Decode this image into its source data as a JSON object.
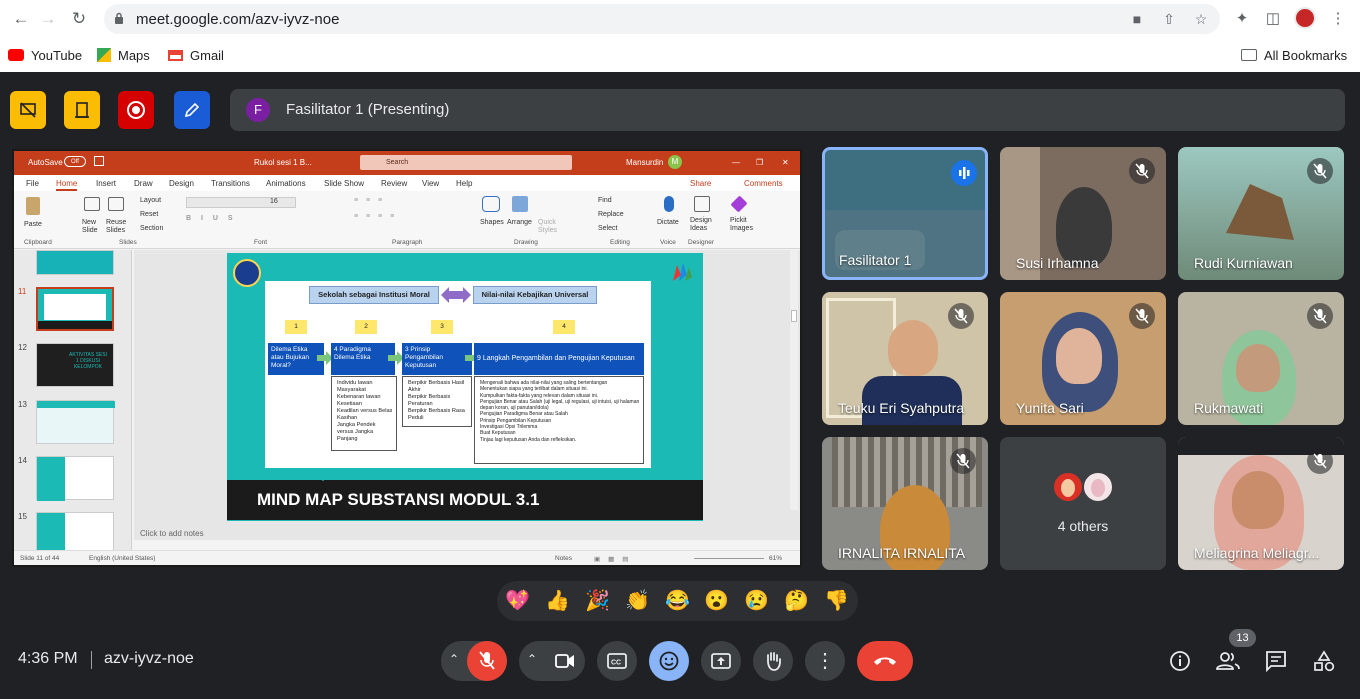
{
  "browser": {
    "url": "meet.google.com/azv-iyvz-noe",
    "bookmarks": [
      "YouTube",
      "Maps",
      "Gmail"
    ],
    "all_bookmarks": "All Bookmarks"
  },
  "meet": {
    "presenter_initial": "F",
    "presenting_label": "Fasilitator 1 (Presenting)",
    "time": "4:36 PM",
    "meeting_code": "azv-iyvz-noe",
    "participant_count": "13",
    "others_label": "4 others"
  },
  "participants": [
    {
      "name": "Fasilitator 1",
      "speaking": true
    },
    {
      "name": "Susi Irhamna",
      "muted": true
    },
    {
      "name": "Rudi Kurniawan",
      "muted": true
    },
    {
      "name": "Teuku Eri Syahputra",
      "muted": true
    },
    {
      "name": "Yunita Sari",
      "muted": true
    },
    {
      "name": "Rukmawati",
      "muted": true
    },
    {
      "name": "IRNALITA IRNALITA",
      "muted": true
    },
    {
      "name": "Meliagrina Meliagr...",
      "muted": true
    }
  ],
  "reactions": [
    "💖",
    "👍",
    "🎉",
    "👏",
    "😂",
    "😮",
    "😢",
    "🤔",
    "👎"
  ],
  "ppt": {
    "autosave": "AutoSave",
    "autosave_state": "Off",
    "file_name": "Rukol sesi 1 B...",
    "search": "Search",
    "user": "Mansurdin",
    "user_initial": "M",
    "menu": [
      "File",
      "Home",
      "Insert",
      "Draw",
      "Design",
      "Transitions",
      "Animations",
      "Slide Show",
      "Review",
      "View",
      "Help"
    ],
    "share": "Share",
    "comments": "Comments",
    "ribbon": {
      "paste": "Paste",
      "clipboard": "Clipboard",
      "new_slide": "New Slide",
      "reuse_slides": "Reuse Slides",
      "layout": "Layout",
      "reset": "Reset",
      "section": "Section",
      "slides": "Slides",
      "font_size": "16",
      "font": "Font",
      "paragraph": "Paragraph",
      "shapes": "Shapes",
      "arrange": "Arrange",
      "quick_styles": "Quick Styles",
      "drawing": "Drawing",
      "find": "Find",
      "replace": "Replace",
      "select": "Select",
      "editing": "Editing",
      "dictate": "Dictate",
      "voice": "Voice",
      "design_ideas": "Design Ideas",
      "designer": "Designer",
      "pickit": "Pickit Images"
    },
    "thumb_numbers": [
      "11",
      "12",
      "13",
      "14",
      "15"
    ],
    "thumb12_text": "AKTIVITAS SESI 1 DISKUSI KELOMPOK",
    "notes_placeholder": "Click to add notes",
    "status": {
      "slide": "Slide 11 of 44",
      "language": "English (United States)",
      "notes": "Notes",
      "zoom": "61%"
    },
    "slide": {
      "header_left": "Sekolah sebagai Institusi Moral",
      "header_right": "Nilai-nilai Kebajikan Universal",
      "numbers": [
        "1",
        "2",
        "3",
        "4"
      ],
      "col1_head": "Dilema Etika atau Bujukan Moral?",
      "col2_head": "4 Paradigma Dilema Etika",
      "col3_head": "3 Prinsip Pengambilan Keputusan",
      "col4_head": "9 Langkah Pengambilan dan Pengujian Keputusan",
      "col2_items": [
        "Individu lawan Masyarakat",
        "Kebenaran lawan Kesetiaan",
        "Keadilan versus Belas Kasihan",
        "Jangka Pendek versus Jangka Panjang"
      ],
      "col3_items": [
        "Berpikir Berbasis Hasil Akhir",
        "Berpikir Berbasis Peraturan",
        "Berpikir Berbasis Rasa Peduli"
      ],
      "col4_items": [
        "Mengenali bahwa ada nilai-nilai yang saling bertentangan",
        "Menentukan siapa yang terlibat dalam situasi ini.",
        "Kumpulkan fakta-fakta yang relevan dalam situasi ini.",
        "Pengujian Benar atau Salah (uji legal, uji regulasi, uji intuisi, uji halaman depan koran, uji panutan/idola)",
        "Pengujian Paradigma Benar atau Salah",
        "Prinsip Pengambilan Keputusan",
        "Investigasi Opsi Trilemma",
        "Buat Keputusan",
        "Tinjau lagi keputusan Anda dan refleksikan."
      ],
      "title": "MIND MAP SUBSTANSI MODUL 3.1"
    }
  },
  "colors": {
    "meet_bg": "#202124",
    "accent_blue": "#8ab4f8",
    "end_call": "#ea4335",
    "ppt_red": "#c43e1c",
    "slide_teal": "#1cbab5"
  }
}
